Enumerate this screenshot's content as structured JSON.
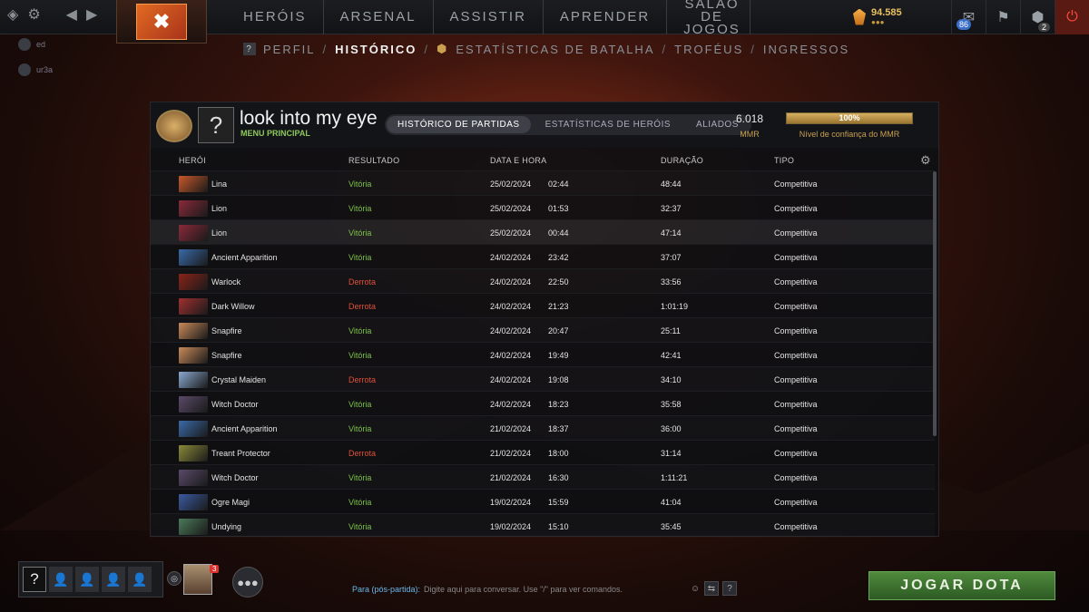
{
  "colors": {
    "accent": "#c8a050",
    "win": "#7cc24a",
    "loss": "#e0503a",
    "play_button": "#3f7a32"
  },
  "topnav": [
    "HERÓIS",
    "ARSENAL",
    "ASSISTIR",
    "APRENDER",
    "SALÃO DE JOGOS"
  ],
  "currency": {
    "shards": "94.585"
  },
  "topright": {
    "level_badge": "86",
    "quest_badge": "2"
  },
  "friends": [
    "ed",
    "ur3a"
  ],
  "subnav": {
    "perfil": "PERFIL",
    "historico": "HISTÓRICO",
    "estatisticas": "ESTATÍSTICAS DE BATALHA",
    "trofeus": "TROFÉUS",
    "ingressos": "INGRESSOS",
    "sep": "/"
  },
  "profile": {
    "avatar_glyph": "?",
    "name": "look into my eye",
    "status": "MENU PRINCIPAL",
    "mmr_value": "6.018",
    "mmr_label": "MMR",
    "confidence_value": "100%",
    "confidence_fraction": 1.0,
    "confidence_label": "Nível de confiança do MMR"
  },
  "tabs": [
    "HISTÓRICO DE PARTIDAS",
    "ESTATÍSTICAS DE HERÓIS",
    "ALIADOS"
  ],
  "columns": {
    "hero": "HERÓI",
    "result": "RESULTADO",
    "datetime": "DATA E HORA",
    "duration": "DURAÇÃO",
    "type": "TIPO"
  },
  "matches": [
    {
      "hero": "Lina",
      "result": "Vitória",
      "date": "25/02/2024",
      "time": "02:44",
      "duration": "48:44",
      "type": "Competitiva",
      "color": "#c8582a"
    },
    {
      "hero": "Lion",
      "result": "Vitória",
      "date": "25/02/2024",
      "time": "01:53",
      "duration": "32:37",
      "type": "Competitiva",
      "color": "#8a2a3a"
    },
    {
      "hero": "Lion",
      "result": "Vitória",
      "date": "25/02/2024",
      "time": "00:44",
      "duration": "47:14",
      "type": "Competitiva",
      "color": "#8a2a3a"
    },
    {
      "hero": "Ancient Apparition",
      "result": "Vitória",
      "date": "24/02/2024",
      "time": "23:42",
      "duration": "37:07",
      "type": "Competitiva",
      "color": "#3a6aa8"
    },
    {
      "hero": "Warlock",
      "result": "Derrota",
      "date": "24/02/2024",
      "time": "22:50",
      "duration": "33:56",
      "type": "Competitiva",
      "color": "#8a2418"
    },
    {
      "hero": "Dark Willow",
      "result": "Derrota",
      "date": "24/02/2024",
      "time": "21:23",
      "duration": "1:01:19",
      "type": "Competitiva",
      "color": "#a03030"
    },
    {
      "hero": "Snapfire",
      "result": "Vitória",
      "date": "24/02/2024",
      "time": "20:47",
      "duration": "25:11",
      "type": "Competitiva",
      "color": "#c88a5a"
    },
    {
      "hero": "Snapfire",
      "result": "Vitória",
      "date": "24/02/2024",
      "time": "19:49",
      "duration": "42:41",
      "type": "Competitiva",
      "color": "#c88a5a"
    },
    {
      "hero": "Crystal Maiden",
      "result": "Derrota",
      "date": "24/02/2024",
      "time": "19:08",
      "duration": "34:10",
      "type": "Competitiva",
      "color": "#8aa8d0"
    },
    {
      "hero": "Witch Doctor",
      "result": "Vitória",
      "date": "24/02/2024",
      "time": "18:23",
      "duration": "35:58",
      "type": "Competitiva",
      "color": "#5a4a6a"
    },
    {
      "hero": "Ancient Apparition",
      "result": "Vitória",
      "date": "21/02/2024",
      "time": "18:37",
      "duration": "36:00",
      "type": "Competitiva",
      "color": "#3a6aa8"
    },
    {
      "hero": "Treant Protector",
      "result": "Derrota",
      "date": "21/02/2024",
      "time": "18:00",
      "duration": "31:14",
      "type": "Competitiva",
      "color": "#8a8a3a"
    },
    {
      "hero": "Witch Doctor",
      "result": "Vitória",
      "date": "21/02/2024",
      "time": "16:30",
      "duration": "1:11:21",
      "type": "Competitiva",
      "color": "#5a4a6a"
    },
    {
      "hero": "Ogre Magi",
      "result": "Vitória",
      "date": "19/02/2024",
      "time": "15:59",
      "duration": "41:04",
      "type": "Competitiva",
      "color": "#3a5aa0"
    },
    {
      "hero": "Undying",
      "result": "Vitória",
      "date": "19/02/2024",
      "time": "15:10",
      "duration": "35:45",
      "type": "Competitiva",
      "color": "#4a7a5a"
    }
  ],
  "bottom": {
    "party_glyph": "?",
    "notif_count": "3",
    "chat_to": "Para (pós-partida):",
    "chat_placeholder": "Digite aqui para conversar. Use \"/\" para ver comandos.",
    "play": "JOGAR DOTA",
    "help_glyph": "?"
  }
}
